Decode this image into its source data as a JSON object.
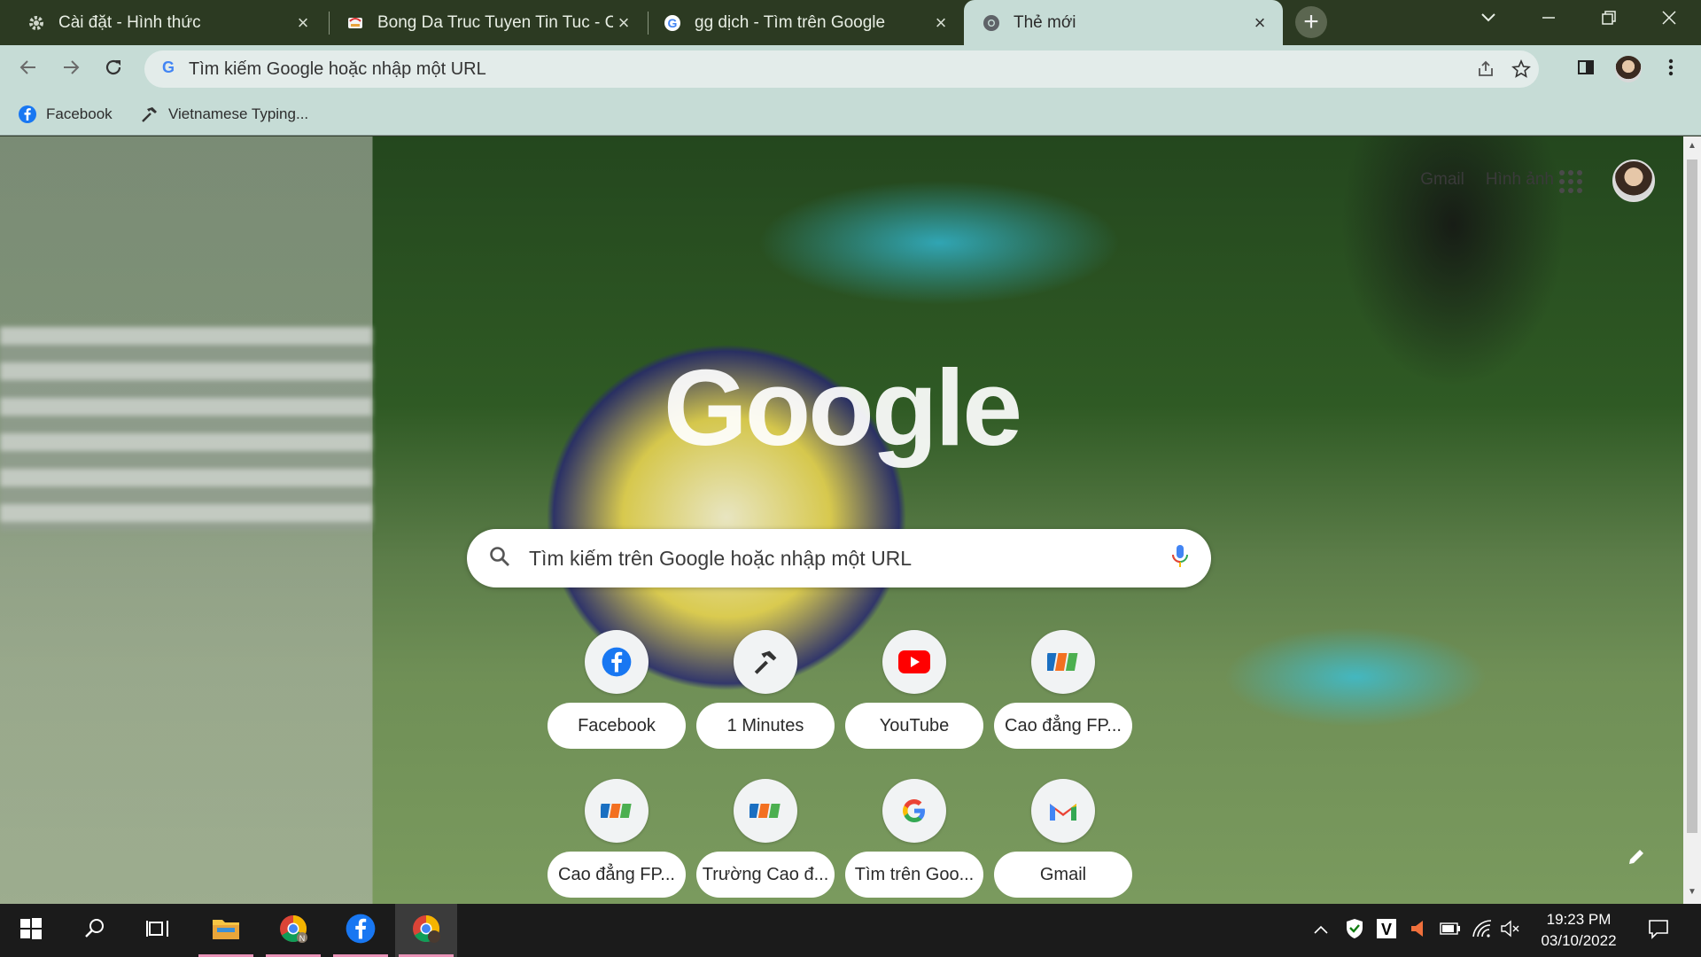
{
  "browser": {
    "tabs": [
      {
        "title": "Cài đặt - Hình thức",
        "icon": "gear-icon",
        "active": false
      },
      {
        "title": "Bong Da Truc Tuyen Tin Tuc - Cú",
        "icon": "site-icon",
        "active": false
      },
      {
        "title": "gg dịch - Tìm trên Google",
        "icon": "google-icon",
        "active": false
      },
      {
        "title": "Thẻ mới",
        "icon": "chrome-icon",
        "active": true
      }
    ],
    "new_tab_symbol": "+",
    "window_controls": {
      "minimize": "—",
      "restore": "❐",
      "close": "✕"
    },
    "toolbar": {
      "address_placeholder": "Tìm kiếm Google hoặc nhập một URL"
    },
    "bookmarks": [
      {
        "label": "Facebook",
        "icon": "facebook-icon"
      },
      {
        "label": "Vietnamese Typing...",
        "icon": "hammer-icon"
      }
    ]
  },
  "ntp": {
    "links": {
      "gmail": "Gmail",
      "images": "Hình ảnh"
    },
    "logo": "Google",
    "search_placeholder": "Tìm kiếm trên Google hoặc nhập một URL",
    "shortcuts": [
      {
        "label": "Facebook",
        "icon": "facebook-icon"
      },
      {
        "label": "1 Minutes",
        "icon": "hammer-icon"
      },
      {
        "label": "YouTube",
        "icon": "youtube-icon"
      },
      {
        "label": "Cao đẳng FP...",
        "icon": "fpt-icon"
      },
      {
        "label": "Cao đẳng FP...",
        "icon": "fpt-icon"
      },
      {
        "label": "Trường Cao đ...",
        "icon": "fpt-icon"
      },
      {
        "label": "Tìm trên Goo...",
        "icon": "google-icon"
      },
      {
        "label": "Gmail",
        "icon": "gmail-icon"
      }
    ]
  },
  "taskbar": {
    "clock_time": "19:23 PM",
    "clock_date": "03/10/2022"
  },
  "colors": {
    "tabstrip": "#2c3a22",
    "toolbar": "#c6dcd6",
    "taskbar": "#1b1b1b",
    "taskbar_running": "#e993b7"
  }
}
